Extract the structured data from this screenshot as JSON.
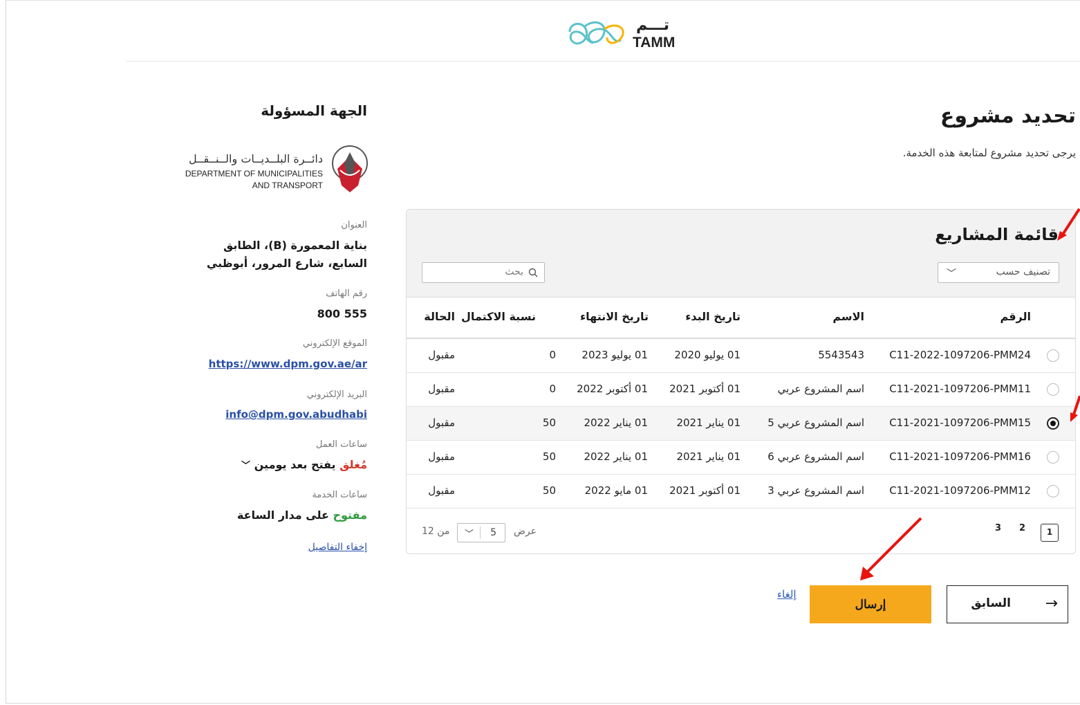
{
  "brand": {
    "name_ar": "تـــم",
    "name_en": "TAMM"
  },
  "main": {
    "title": "تحديد مشروع",
    "subtitle": "يرجى تحديد مشروع لمتابعة هذه الخدمة."
  },
  "projects": {
    "title": "قائمة المشاريع",
    "sort_placeholder": "تصنيف حسب",
    "search_placeholder": "بحث",
    "columns": {
      "number": "الرقم",
      "name": "الاسم",
      "start": "تاريخ البدء",
      "end": "تاريخ الانتهاء",
      "completion": "نسبة الاكتمال",
      "status": "الحالة"
    },
    "rows": [
      {
        "number": "C11-2022-1097206-PMM24",
        "name": "5543543",
        "start": "01 يوليو 2020",
        "end": "01 يوليو 2023",
        "completion": "0",
        "status": "مقبول",
        "selected": false
      },
      {
        "number": "C11-2021-1097206-PMM11",
        "name": "اسم المشروع عربي",
        "start": "01 أكتوبر 2021",
        "end": "01 أكتوبر 2022",
        "completion": "0",
        "status": "مقبول",
        "selected": false
      },
      {
        "number": "C11-2021-1097206-PMM15",
        "name": "اسم المشروع عربي 5",
        "start": "01 يناير 2021",
        "end": "01 يناير 2022",
        "completion": "50",
        "status": "مقبول",
        "selected": true
      },
      {
        "number": "C11-2021-1097206-PMM16",
        "name": "اسم المشروع عربي 6",
        "start": "01 يناير 2021",
        "end": "01 يناير 2022",
        "completion": "50",
        "status": "مقبول",
        "selected": false
      },
      {
        "number": "C11-2021-1097206-PMM12",
        "name": "اسم المشروع عربي 3",
        "start": "01 أكتوبر 2021",
        "end": "01 مايو 2022",
        "completion": "50",
        "status": "مقبول",
        "selected": false
      }
    ],
    "pagination": {
      "pages": [
        "1",
        "2",
        "3"
      ],
      "current": "1",
      "show_label": "عرض",
      "per_page": "5",
      "of_total": "من 12"
    }
  },
  "actions": {
    "send": "إرسال",
    "previous": "السابق",
    "cancel": "إلغاء"
  },
  "sidebar": {
    "title": "الجهة المسؤولة",
    "dept_ar": "دائــرة البلــديــات والــنــقــل",
    "dept_en_1": "DEPARTMENT OF MUNICIPALITIES",
    "dept_en_2": "AND TRANSPORT",
    "address_label": "العنوان",
    "address_1": "بناية المعمورة (B)، الطابق",
    "address_2": "السابع، شارع المرور، أبوظبي",
    "phone_label": "رقم الهاتف",
    "phone": "800 555",
    "website_label": "الموقع الإلكتروني",
    "website": "https://www.dpm.gov.ae/ar",
    "email_label": "البريد الإلكتروني",
    "email": "info@dpm.gov.abudhabi",
    "work_hours_label": "ساعات العمل",
    "work_status": "مُغلق",
    "work_opens": "يفتح بعد يومين",
    "service_hours_label": "ساعات الخدمة",
    "service_status": "مفتوح",
    "service_hours": "على مدار الساعة",
    "hide_details": "إخفاء التفاصيل"
  },
  "colors": {
    "accent": "#f6a81c",
    "link": "#2a4fa6",
    "closed": "#d33a2c",
    "open": "#2e9a3e",
    "annotation": "#e8140f"
  }
}
